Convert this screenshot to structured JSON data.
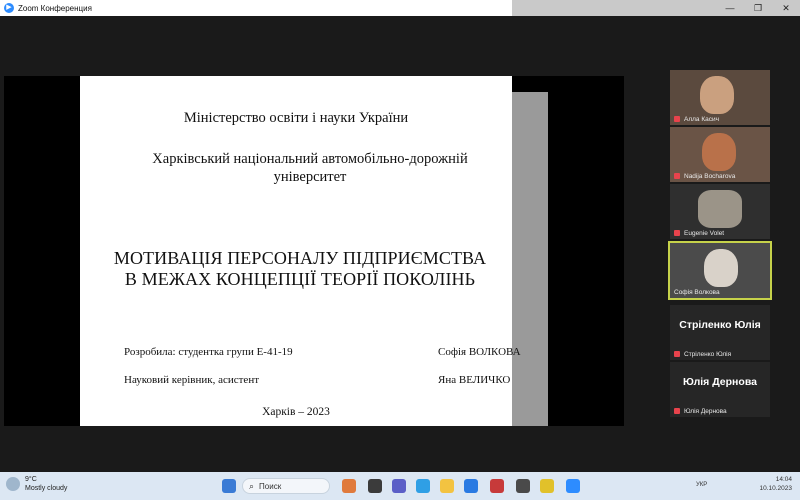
{
  "window": {
    "title": "Zoom Конференция",
    "app_icon": "zoom-icon",
    "buttons": [
      "—",
      "❐",
      "✕"
    ]
  },
  "slide": {
    "ministry": "Міністерство освіти і науки України",
    "university": "Харківський національний автомобільно-дорожній університет",
    "topic_line1": "МОТИВАЦІЯ ПЕРСОНАЛУ ПІДПРИЄМСТВА",
    "topic_line2": "В МЕЖАХ КОНЦЕПЦІЇ ТЕОРІЇ ПОКОЛІНЬ",
    "author_label": "Розробила: студентка групи Е-41-19",
    "author_name": "Софія ВОЛКОВА",
    "supervisor_label": "Науковий керівник, асистент",
    "supervisor_name": "Яна ВЕЛИЧКО",
    "city_year": "Харків – 2023"
  },
  "participants": [
    {
      "name": "Алла Касич",
      "type": "video",
      "muted": true
    },
    {
      "name": "Nadija Bocharova",
      "type": "video",
      "muted": true
    },
    {
      "name": "Eugenie Volet",
      "type": "video",
      "muted": true
    },
    {
      "name": "Софія Волкова",
      "type": "video",
      "muted": false,
      "active": true
    },
    {
      "name": "Стріленко Юлія",
      "type": "name",
      "muted": true
    },
    {
      "name": "Юлія Дернова",
      "type": "name",
      "muted": true
    }
  ],
  "taskbar": {
    "weather_temp": "9°C",
    "weather_desc": "Mostly cloudy",
    "search_placeholder": "Поиск",
    "language": "УКР",
    "time": "14:04",
    "date": "10.10.2023"
  }
}
